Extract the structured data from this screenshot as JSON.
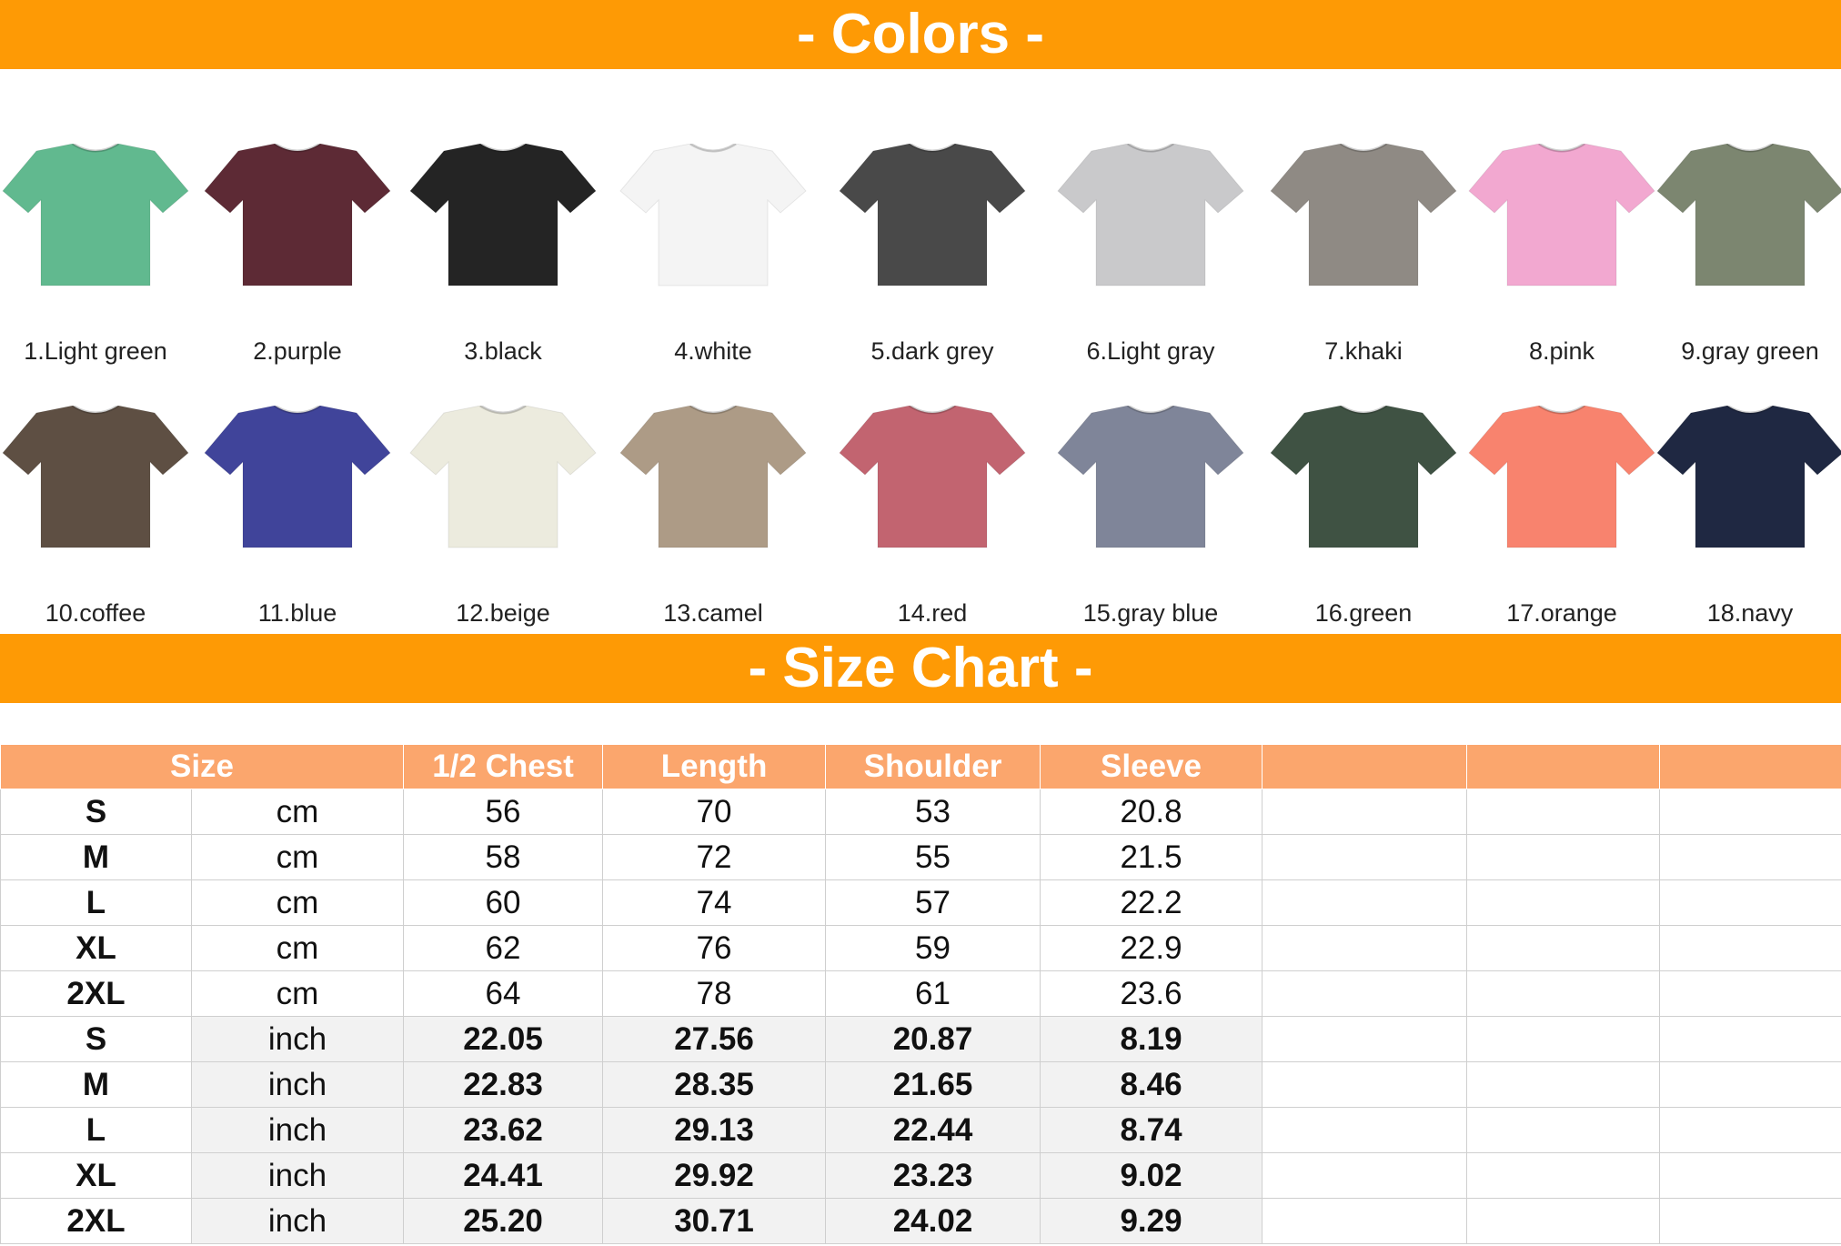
{
  "colors_banner": "- Colors -",
  "size_banner": "- Size Chart -",
  "shirts": [
    {
      "label": "1.Light green",
      "color": "#61b98f"
    },
    {
      "label": "2.purple",
      "color": "#5d2a35"
    },
    {
      "label": "3.black",
      "color": "#242424"
    },
    {
      "label": "4.white",
      "color": "#f4f4f4"
    },
    {
      "label": "5.dark grey",
      "color": "#494949"
    },
    {
      "label": "6.Light gray",
      "color": "#c9c9cb"
    },
    {
      "label": "7.khaki",
      "color": "#8f8a84"
    },
    {
      "label": "8.pink",
      "color": "#f2a8d0"
    },
    {
      "label": "9.gray green",
      "color": "#7c8670"
    },
    {
      "label": "10.coffee",
      "color": "#5e4f43"
    },
    {
      "label": "11.blue",
      "color": "#40449a"
    },
    {
      "label": "12.beige",
      "color": "#ecebde"
    },
    {
      "label": "13.camel",
      "color": "#ad9b86"
    },
    {
      "label": "14.red",
      "color": "#c26470"
    },
    {
      "label": "15.gray blue",
      "color": "#7f8599"
    },
    {
      "label": "16.green",
      "color": "#3f5243"
    },
    {
      "label": "17.orange",
      "color": "#f8836e"
    },
    {
      "label": "18.navy",
      "color": "#1f2842"
    }
  ],
  "table": {
    "headers": [
      "Size",
      "1/2 Chest",
      "Length",
      "Shoulder",
      "Sleeve"
    ],
    "rows": [
      {
        "size": "S",
        "unit": "cm",
        "chest": "56",
        "length": "70",
        "shoulder": "53",
        "sleeve": "20.8"
      },
      {
        "size": "M",
        "unit": "cm",
        "chest": "58",
        "length": "72",
        "shoulder": "55",
        "sleeve": "21.5"
      },
      {
        "size": "L",
        "unit": "cm",
        "chest": "60",
        "length": "74",
        "shoulder": "57",
        "sleeve": "22.2"
      },
      {
        "size": "XL",
        "unit": "cm",
        "chest": "62",
        "length": "76",
        "shoulder": "59",
        "sleeve": "22.9"
      },
      {
        "size": "2XL",
        "unit": "cm",
        "chest": "64",
        "length": "78",
        "shoulder": "61",
        "sleeve": "23.6"
      },
      {
        "size": "S",
        "unit": "inch",
        "chest": "22.05",
        "length": "27.56",
        "shoulder": "20.87",
        "sleeve": "8.19"
      },
      {
        "size": "M",
        "unit": "inch",
        "chest": "22.83",
        "length": "28.35",
        "shoulder": "21.65",
        "sleeve": "8.46"
      },
      {
        "size": "L",
        "unit": "inch",
        "chest": "23.62",
        "length": "29.13",
        "shoulder": "22.44",
        "sleeve": "8.74"
      },
      {
        "size": "XL",
        "unit": "inch",
        "chest": "24.41",
        "length": "29.92",
        "shoulder": "23.23",
        "sleeve": "9.02"
      },
      {
        "size": "2XL",
        "unit": "inch",
        "chest": "25.20",
        "length": "30.71",
        "shoulder": "24.02",
        "sleeve": "9.29"
      }
    ]
  }
}
